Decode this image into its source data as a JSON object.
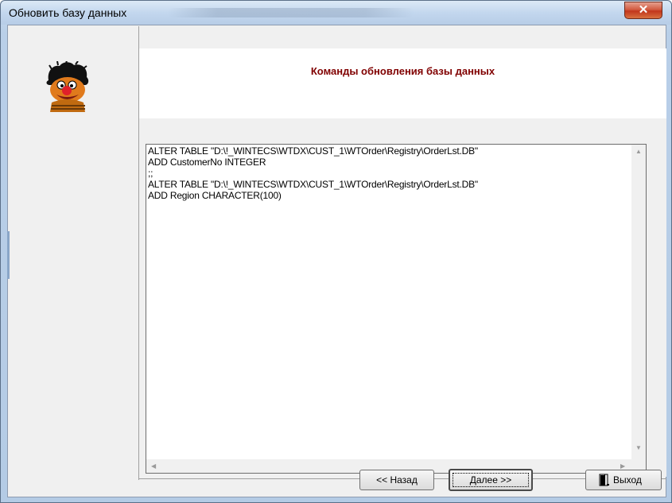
{
  "window": {
    "title": "Обновить базу данных"
  },
  "header": {
    "title": "Команды обновления базы данных",
    "color": "#800000"
  },
  "memo": {
    "lines": [
      "ALTER TABLE \"D:\\!_WINTECS\\WTDX\\CUST_1\\WTOrder\\Registry\\OrderLst.DB\"",
      "ADD CustomerNo INTEGER",
      ";;",
      "ALTER TABLE \"D:\\!_WINTECS\\WTDX\\CUST_1\\WTOrder\\Registry\\OrderLst.DB\"",
      "ADD Region CHARACTER(100)"
    ]
  },
  "buttons": {
    "back": "<< Назад",
    "next": "Далее >>",
    "exit": "Выход"
  },
  "icons": {
    "close": "close-icon",
    "mascot": "mascot-icon",
    "exit": "exit-door-icon"
  }
}
